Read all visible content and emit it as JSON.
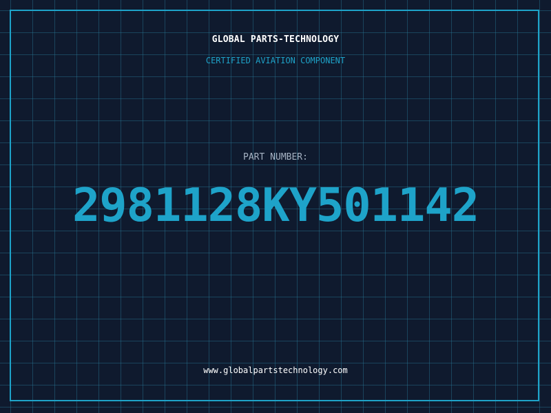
{
  "header": {
    "company": "GLOBAL PARTS-TECHNOLOGY",
    "subtitle": "CERTIFIED AVIATION COMPONENT"
  },
  "part": {
    "label": "PART NUMBER:",
    "number": "2981128KY501142"
  },
  "footer": {
    "url": "www.globalpartstechnology.com"
  },
  "colors": {
    "background": "#0f1a2e",
    "accent": "#1ea3c9",
    "grid": "#28788f",
    "text": "#ffffff",
    "muted": "#a6b3c3"
  }
}
